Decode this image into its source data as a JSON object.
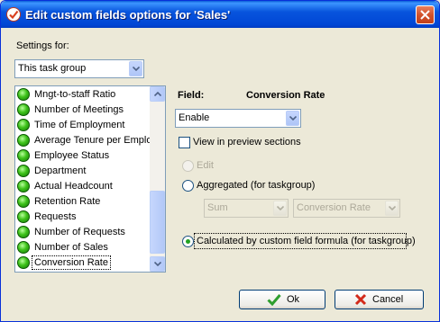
{
  "window": {
    "title": "Edit custom fields options for  'Sales'"
  },
  "settings_for": {
    "label": "Settings for:",
    "value": "This task group"
  },
  "fields_list": {
    "items": [
      "Mngt-to-staff Ratio",
      "Number of Meetings",
      "Time of Employment",
      "Average Tenure per Emplo",
      "Employee Status",
      "Department",
      "Actual Headcount",
      "Retention Rate",
      "Requests",
      "Number of Requests",
      "Number of Sales",
      "Conversion Rate"
    ],
    "selected": "Conversion Rate"
  },
  "field_panel": {
    "field_label": "Field:",
    "field_name": "Conversion Rate",
    "mode_value": "Enable",
    "view_in_preview_label": "View in preview sections",
    "view_in_preview_checked": false,
    "edit_label": "Edit",
    "aggregated_label": "Aggregated (for taskgroup)",
    "agg_function_value": "Sum",
    "agg_field_value": "Conversion Rate",
    "calculated_label": "Calculated by custom field formula (for taskgroup)",
    "selected_option": "calculated"
  },
  "buttons": {
    "ok": "Ok",
    "cancel": "Cancel"
  },
  "colors": {
    "titlebar": "#0855dd",
    "dialog_bg": "#ece9d8",
    "radio_dot": "#22a222",
    "ok_icon": "#2e9e2e",
    "cancel_icon": "#d32a1a"
  }
}
